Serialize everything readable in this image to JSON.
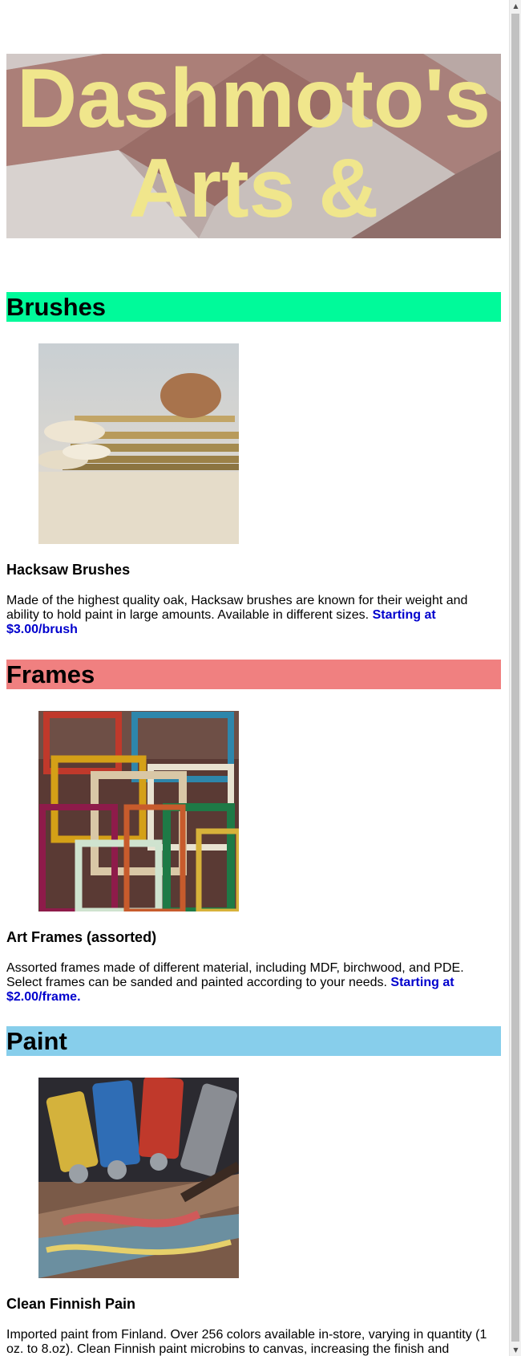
{
  "banner": {
    "title_line1": "Dashmoto's",
    "title_line2": "Arts & Crafts",
    "title_color": "#f0e68c"
  },
  "sections": [
    {
      "heading": "Brushes",
      "heading_color": "#00fa9a",
      "image_icon": "brushes-photo",
      "product_name": "Hacksaw Brushes",
      "description": "Made of the highest quality oak, Hacksaw brushes are known for their weight and ability to hold paint in large amounts. Available in different sizes. ",
      "price": "Starting at $3.00/brush"
    },
    {
      "heading": "Frames",
      "heading_color": "#f08080",
      "image_icon": "frames-photo",
      "product_name": "Art Frames (assorted)",
      "description": "Assorted frames made of different material, including MDF, birchwood, and PDE. Select frames can be sanded and painted according to your needs. ",
      "price": "Starting at $2.00/frame."
    },
    {
      "heading": "Paint",
      "heading_color": "#87ceeb",
      "image_icon": "paint-photo",
      "product_name": "Clean Finnish Pain",
      "description": "Imported paint from Finland. Over 256 colors available in-store, varying in quantity (1 oz. to 8.oz). Clean Finnish paint microbins to canvas, increasing the finish and",
      "price": ""
    }
  ],
  "colors": {
    "price_text": "#0000cd"
  },
  "scrollbar": {
    "up_icon": "scroll-up-arrow-icon",
    "down_icon": "scroll-down-arrow-icon"
  }
}
